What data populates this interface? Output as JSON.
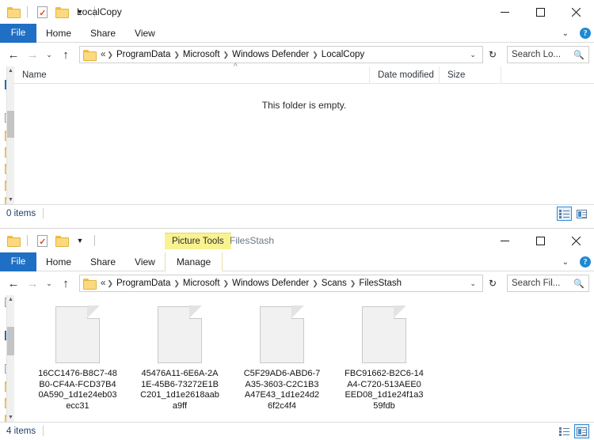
{
  "windows": [
    {
      "id": "local",
      "title": "LocalCopy",
      "quick_access": {
        "folder_icon": "folder-icon",
        "properties_icon": "properties-icon",
        "new_folder_icon": "new-folder-icon",
        "customize_icon": "chevron-down-icon"
      },
      "tabs": [
        {
          "label": "File",
          "active": true
        },
        {
          "label": "Home",
          "active": false
        },
        {
          "label": "Share",
          "active": false
        },
        {
          "label": "View",
          "active": false
        }
      ],
      "ribbon": {
        "collapse_icon": "chevron-down-icon",
        "help_icon": "help-icon",
        "help_label": "?"
      },
      "window_controls": {
        "minimize": "minimize-icon",
        "maximize": "maximize-icon",
        "close": "close-icon"
      },
      "address": {
        "back_icon": "back-arrow-icon",
        "forward_icon": "forward-arrow-icon",
        "recent_icon": "chevron-down-icon",
        "up_icon": "up-arrow-icon",
        "lead": "«",
        "crumbs": [
          "ProgramData",
          "Microsoft",
          "Windows Defender",
          "LocalCopy"
        ],
        "dropdown_icon": "chevron-down-icon",
        "refresh_icon": "refresh-icon",
        "refresh_glyph": "↻"
      },
      "search": {
        "placeholder": "Search Lo...",
        "icon": "search-icon"
      },
      "columns": [
        {
          "label": "Name"
        },
        {
          "label": "Date modified"
        },
        {
          "label": "Size"
        }
      ],
      "sort_caret": "^",
      "empty_message": "This folder is empty.",
      "files": [],
      "status": {
        "count": "0 items",
        "view_details_icon": "details-view-icon",
        "view_tiles_icon": "tiles-view-icon",
        "active_view": "details"
      }
    },
    {
      "id": "stash",
      "title": "FilesStash",
      "context_tab": {
        "label": "Picture Tools",
        "sub_label": "Manage"
      },
      "quick_access": {
        "folder_icon": "folder-icon",
        "properties_icon": "properties-icon",
        "new_folder_icon": "new-folder-icon",
        "customize_icon": "chevron-down-icon"
      },
      "tabs": [
        {
          "label": "File",
          "active": true
        },
        {
          "label": "Home",
          "active": false
        },
        {
          "label": "Share",
          "active": false
        },
        {
          "label": "View",
          "active": false
        }
      ],
      "ribbon": {
        "collapse_icon": "chevron-down-icon",
        "help_icon": "help-icon",
        "help_label": "?"
      },
      "window_controls": {
        "minimize": "minimize-icon",
        "maximize": "maximize-icon",
        "close": "close-icon"
      },
      "address": {
        "back_icon": "back-arrow-icon",
        "forward_icon": "forward-arrow-icon",
        "recent_icon": "chevron-down-icon",
        "up_icon": "up-arrow-icon",
        "lead": "«",
        "crumbs": [
          "ProgramData",
          "Microsoft",
          "Windows Defender",
          "Scans",
          "FilesStash"
        ],
        "dropdown_icon": "chevron-down-icon",
        "refresh_icon": "refresh-icon",
        "refresh_glyph": "↻"
      },
      "search": {
        "placeholder": "Search Fil...",
        "icon": "search-icon"
      },
      "files": [
        {
          "name": "16CC1476-B8C7-48B0-CF4A-FCD37B40A590_1d1e24eb03ecc31"
        },
        {
          "name": "45476A11-6E6A-2A1E-45B6-73272E1BC201_1d1e2618aaba9ff"
        },
        {
          "name": "C5F29AD6-ABD6-7A35-3603-C2C1B3A47E43_1d1e24d26f2c4f4"
        },
        {
          "name": "FBC91662-B2C6-14A4-C720-513AEE0EED08_1d1e24f1a359fdb"
        }
      ],
      "status": {
        "count": "4 items",
        "view_details_icon": "details-view-icon",
        "view_tiles_icon": "tiles-view-icon",
        "active_view": "tiles"
      }
    }
  ],
  "nav_pane": {
    "items": [
      {
        "icon": "desktop-icon"
      },
      {
        "icon": "downloads-icon"
      },
      {
        "icon": "documents-icon"
      },
      {
        "icon": "music-icon"
      },
      {
        "icon": "pictures-icon"
      },
      {
        "icon": "folder-icon"
      },
      {
        "icon": "folder-icon"
      },
      {
        "icon": "folder-icon"
      },
      {
        "icon": "folder-icon"
      },
      {
        "icon": "folder-icon"
      }
    ],
    "scroll_up": "▲",
    "scroll_down": "▼"
  },
  "colors": {
    "file_tab_blue": "#1f6fc4",
    "context_tab_yellow": "#f9f291",
    "status_text": "#1c3f66",
    "selection_blue": "#2f8ad8"
  }
}
